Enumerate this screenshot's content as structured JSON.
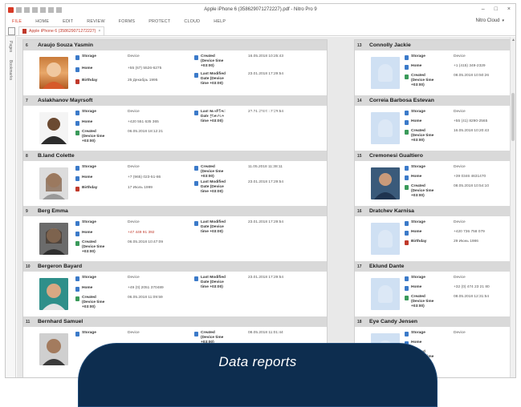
{
  "window": {
    "title": "Apple iPhone 6 (358629071272227).pdf - Nitro Pro 9",
    "controls": [
      "–",
      "□",
      "×"
    ]
  },
  "menu": [
    "FILE",
    "HOME",
    "EDIT",
    "REVIEW",
    "FORMS",
    "PROTECT",
    "CLOUD",
    "HELP"
  ],
  "account": "Nitro Cloud",
  "doc_tab": "Apple iPhone 6 (358629071272227)",
  "side_rail": [
    "Pages",
    "Bookmarks"
  ],
  "watermark": "Data reports",
  "caption": "Data reports",
  "contacts_left": [
    {
      "num": "6",
      "name": "Araujo Souza Yasmin",
      "photo": true,
      "fields": [
        {
          "label": "Storage",
          "value": "Device"
        },
        {
          "label": "Home",
          "value": "+55 (67) 5526-6275"
        },
        {
          "label": "Birthday",
          "value": "25 Декабрь 1995"
        }
      ],
      "fields2": [
        {
          "label": "Created (Device time +03:00)",
          "value": "16.05.2018 10:25:43"
        },
        {
          "label": "Last Modified Date (Device time +03:00)",
          "value": "23.01.2018 17:29:54"
        }
      ]
    },
    {
      "num": "7",
      "name": "Aslakhanov Mayrsoft",
      "photo": true,
      "fields": [
        {
          "label": "Storage",
          "value": "Device"
        },
        {
          "label": "Home",
          "value": "+420 551 635 365"
        },
        {
          "label": "Created (Device time +03:00)",
          "value": "06.05.2018 18:12:21"
        }
      ],
      "fields2": [
        {
          "label": "Last Modified Date (Device time +03:00)",
          "value": "23.01.2018 17:29:54"
        }
      ]
    },
    {
      "num": "8",
      "name": "B.land Colette",
      "photo": true,
      "fields": [
        {
          "label": "Storage",
          "value": "Device"
        },
        {
          "label": "Home",
          "value": "+7 (965) 023-51-86"
        },
        {
          "label": "Birthday",
          "value": "17 Июль 1999"
        }
      ],
      "fields2": [
        {
          "label": "Created (Device time +03:00)",
          "value": "11.05.2018 11:38:11"
        },
        {
          "label": "Last Modified Date (Device time +03:00)",
          "value": "23.01.2018 17:29:54"
        }
      ]
    },
    {
      "num": "9",
      "name": "Berg Emma",
      "photo": true,
      "fields": [
        {
          "label": "Storage",
          "value": "Device"
        },
        {
          "label": "Home",
          "value": "+47 449 91 392"
        },
        {
          "label": "Created (Device time +03:00)",
          "value": "06.05.2018 10:47:09"
        }
      ],
      "fields2": [
        {
          "label": "Last Modified Date (Device time +03:00)",
          "value": "23.01.2018 17:29:54"
        }
      ]
    },
    {
      "num": "10",
      "name": "Bergeron Bayard",
      "photo": true,
      "fields": [
        {
          "label": "Storage",
          "value": "Device"
        },
        {
          "label": "Home",
          "value": "+49 (0) 2051 370489"
        },
        {
          "label": "Created (Device time +03:00)",
          "value": "06.05.2018 11:09:59"
        }
      ],
      "fields2": [
        {
          "label": "Last Modified Date (Device time +03:00)",
          "value": "23.01.2018 17:29:54"
        }
      ]
    },
    {
      "num": "11",
      "name": "Bernhard Samuel",
      "photo": true,
      "fields": [
        {
          "label": "Storage",
          "value": "Device"
        }
      ],
      "fields2": [
        {
          "label": "Created (Device time +03:00)",
          "value": "08.05.2018 11:01:44"
        }
      ]
    }
  ],
  "contacts_right": [
    {
      "num": "13",
      "name": "Connolly Jackie",
      "fields": [
        {
          "label": "Storage",
          "value": "Device"
        },
        {
          "label": "Home",
          "value": "+1 (415) 349-2329"
        },
        {
          "label": "Created (Device time +03:00)",
          "value": "08.05.2018 10:50:26"
        }
      ]
    },
    {
      "num": "14",
      "name": "Correia Barbosa Estevan",
      "fields": [
        {
          "label": "Storage",
          "value": "Device"
        },
        {
          "label": "Home",
          "value": "+55 (41) 8290-2565"
        },
        {
          "label": "Created (Device time +03:00)",
          "value": "16.05.2018 10:20:43"
        }
      ]
    },
    {
      "num": "15",
      "name": "Cremonesi Gualtiero",
      "fields": [
        {
          "label": "Storage",
          "value": "Device"
        },
        {
          "label": "Home",
          "value": "+39 0346 4631470"
        },
        {
          "label": "Created (Device time +03:00)",
          "value": "08.05.2018 10:54:10"
        }
      ]
    },
    {
      "num": "16",
      "name": "Dratchev Karnisa",
      "fields": [
        {
          "label": "Storage",
          "value": "Device"
        },
        {
          "label": "Home",
          "value": "+420 736 758 079"
        },
        {
          "label": "Birthday",
          "value": "29 Июнь 1986"
        }
      ]
    },
    {
      "num": "17",
      "name": "Eklund Dante",
      "fields": [
        {
          "label": "Storage",
          "value": "Device"
        },
        {
          "label": "Home",
          "value": "+32 (0) 474 23 21 80"
        },
        {
          "label": "Created (Device time +03:00)",
          "value": "08.05.2018 12:31:54"
        }
      ]
    },
    {
      "num": "18",
      "name": "Eye Candy Jensen",
      "fields": [
        {
          "label": "Storage",
          "value": "Device"
        },
        {
          "label": "Home",
          "value": ""
        },
        {
          "label": "Created (Device time +03:00)",
          "value": ""
        }
      ]
    }
  ],
  "colors": {
    "accent": "#d83a26",
    "header_bg": "#d9d9d9",
    "overlay": "#0d2d4f",
    "phone_icon": "#3b7ac9"
  }
}
